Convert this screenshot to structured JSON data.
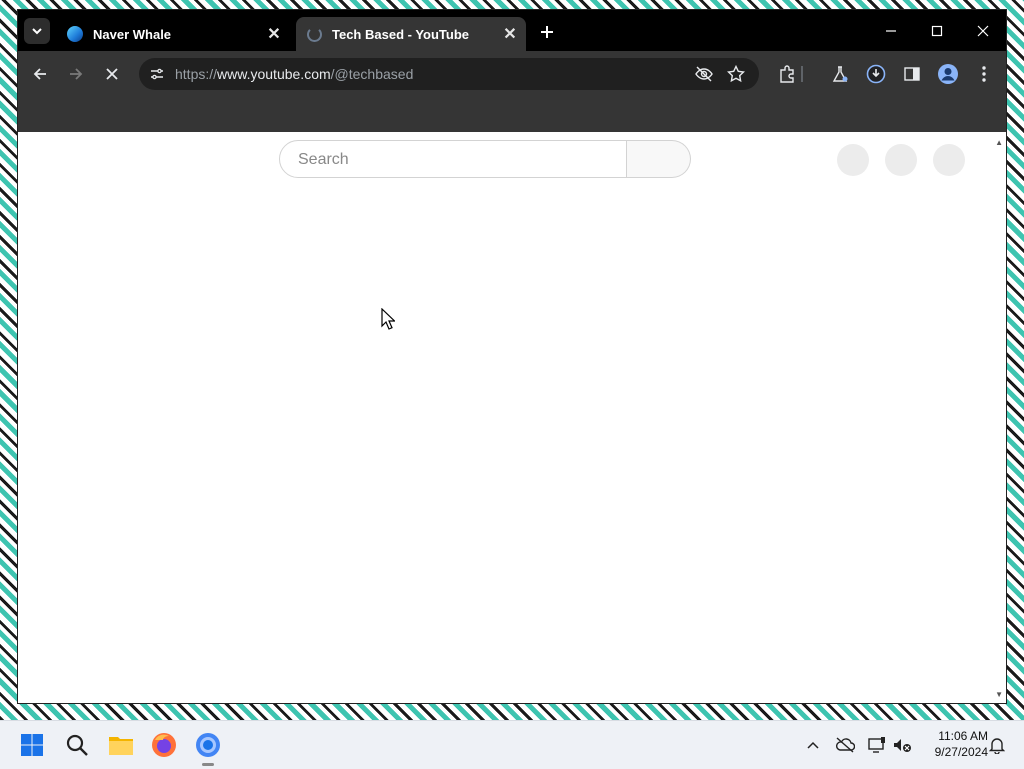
{
  "browser": {
    "tabs": [
      {
        "title": "Naver Whale",
        "favicon": "whale-icon",
        "active": false
      },
      {
        "title": "Tech Based - YouTube",
        "favicon": "loading-spinner-icon",
        "active": true
      }
    ],
    "url_prefix": "https://",
    "url_host": "www.youtube.com",
    "url_path": "/@techbased"
  },
  "page": {
    "search_placeholder": "Search",
    "search_value": ""
  },
  "taskbar": {
    "apps": [
      "windows-start-icon",
      "search-icon",
      "file-explorer-icon",
      "firefox-icon",
      "chrome-icon"
    ],
    "time": "11:06 AM",
    "date": "9/27/2024"
  },
  "colors": {
    "tabbar": "#000000",
    "toolbar": "#353535",
    "omnibox": "#202020",
    "desktop_accent": "#3ec4b0"
  }
}
